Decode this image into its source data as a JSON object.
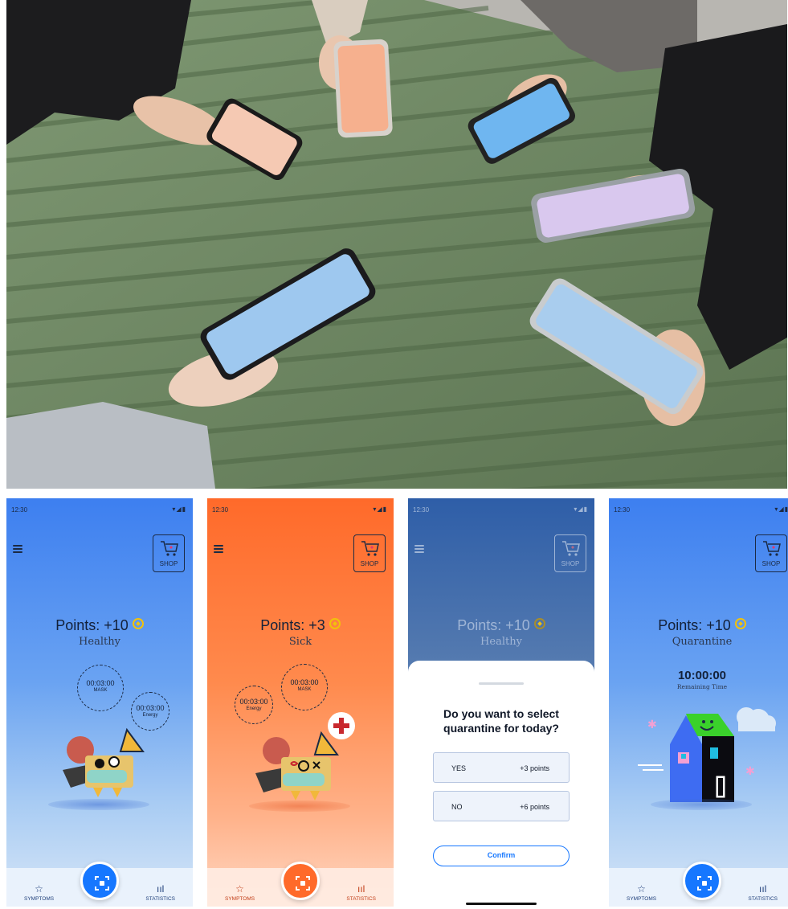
{
  "status_bar": {
    "time": "12:30",
    "icons": "▾◢▮"
  },
  "shop": {
    "label": "SHOP"
  },
  "tabs": {
    "symptoms": "SYMPTOMS",
    "statistics": "STATISTICS"
  },
  "screens": [
    {
      "points_label": "Points: +10",
      "state": "Healthy",
      "timers": [
        {
          "time": "00:03:00",
          "label": "MASK"
        },
        {
          "time": "00:03:00",
          "label": "Energy"
        }
      ]
    },
    {
      "points_label": "Points: +3",
      "state": "Sick",
      "timers": [
        {
          "time": "00:03:00",
          "label": "Energy"
        },
        {
          "time": "00:03:00",
          "label": "MASK"
        }
      ]
    },
    {
      "points_label": "Points: +10",
      "state": "Healthy",
      "dialog": {
        "question": "Do you want to select quarantine for today?",
        "options": [
          {
            "key": "YES",
            "value": "+3 points"
          },
          {
            "key": "NO",
            "value": "+6 points"
          }
        ],
        "confirm": "Confirm"
      }
    },
    {
      "points_label": "Points: +10",
      "state": "Quarantine",
      "remaining_time": "10:00:00",
      "remaining_label": "Remaining Time"
    }
  ],
  "colors": {
    "healthy_accent": "#1677ff",
    "sick_accent": "#ff6a2a",
    "coin": "#f2c20a"
  }
}
